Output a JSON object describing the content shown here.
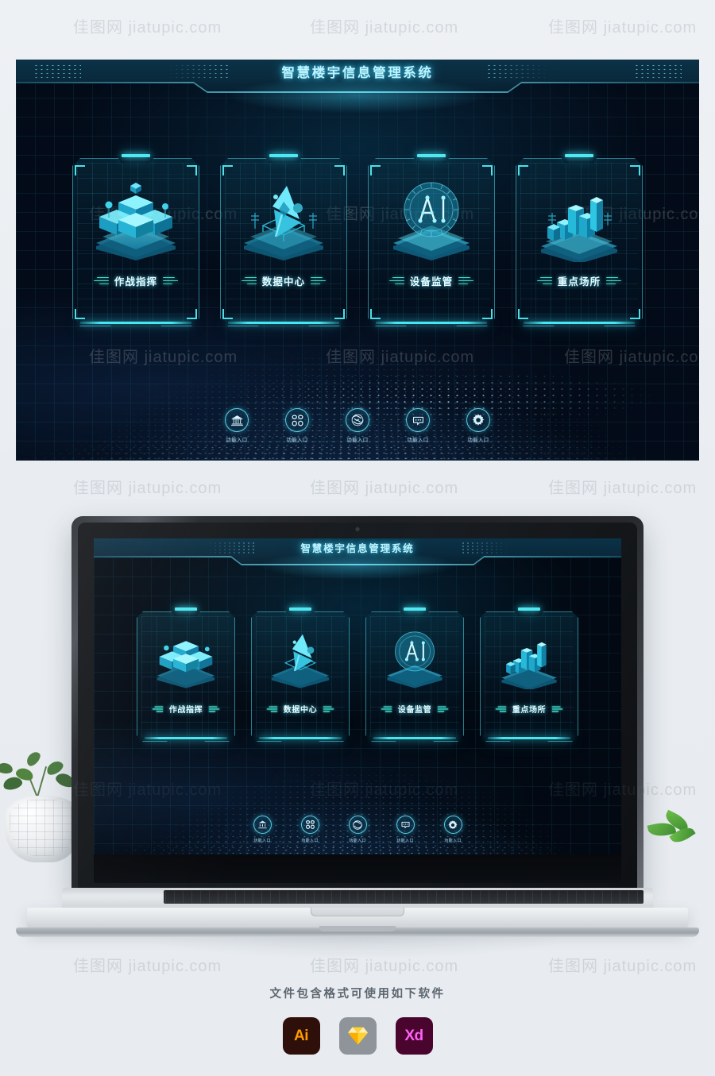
{
  "app": {
    "title": "智慧楼宇信息管理系统",
    "accent_cyan": "#4fe8f0",
    "accent_teal": "#3fd6c8",
    "bg_dark": "#030b18",
    "header_bg": "#0a2a3d"
  },
  "cards": [
    {
      "label": "作战指挥",
      "icon": "isometric-cubes-icon"
    },
    {
      "label": "数据中心",
      "icon": "satellite-dish-icon"
    },
    {
      "label": "设备监管",
      "icon": "ai-circle-icon"
    },
    {
      "label": "重点场所",
      "icon": "isometric-buildings-icon"
    }
  ],
  "functions": [
    {
      "label": "功能入口",
      "icon": "bank-building-icon"
    },
    {
      "label": "功能入口",
      "icon": "grid-clover-icon"
    },
    {
      "label": "功能入口",
      "icon": "handshake-icon"
    },
    {
      "label": "功能入口",
      "icon": "chat-bubble-icon"
    },
    {
      "label": "功能入口",
      "icon": "gear-icon"
    }
  ],
  "watermark": {
    "cn": "佳图网",
    "en": "jiatupic.com"
  },
  "footer": {
    "text": "文件包含格式可使用如下软件",
    "apps": [
      {
        "name": "Illustrator",
        "short": "Ai"
      },
      {
        "name": "Sketch",
        "short": ""
      },
      {
        "name": "Adobe XD",
        "short": "Xd"
      }
    ]
  }
}
